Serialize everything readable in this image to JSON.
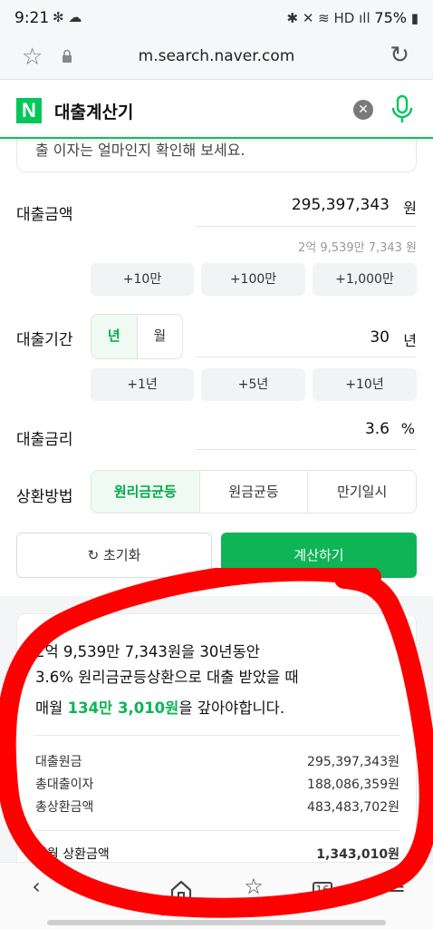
{
  "status_bar": {
    "time": "9:21",
    "left_icons": "✻ ☁",
    "right_icons": "✱ ✕ ≋ HD ıll",
    "battery": "75%"
  },
  "address_bar": {
    "url": "m.search.naver.com"
  },
  "search": {
    "logo": "N",
    "query": "대출계산기"
  },
  "intro": {
    "text": "출 이자는 얼마인지 확인해 보세요."
  },
  "loan_amount": {
    "label": "대출금액",
    "value": "295,397,343",
    "unit": "원",
    "hint": "2억 9,539만 7,343 원",
    "chips": [
      "+10만",
      "+100만",
      "+1,000만"
    ]
  },
  "loan_period": {
    "label": "대출기간",
    "toggle": [
      "년",
      "월"
    ],
    "value": "30",
    "unit": "년",
    "chips": [
      "+1년",
      "+5년",
      "+10년"
    ]
  },
  "loan_rate": {
    "label": "대출금리",
    "value": "3.6",
    "unit": "%"
  },
  "repayment": {
    "label": "상환방법",
    "options": [
      "원리금균등",
      "원금균등",
      "만기일시"
    ]
  },
  "actions": {
    "reset": "초기화",
    "calculate": "계산하기"
  },
  "result": {
    "line1": "2억 9,539만 7,343원을 30년동안",
    "line2": "3.6% 원리금균등상환으로 대출 받았을 때",
    "monthly_prefix": "매월 ",
    "monthly_amount": "134만 3,010원",
    "monthly_suffix": "을 갚아야합니다.",
    "rows": [
      {
        "label": "대출원금",
        "value": "295,397,343원"
      },
      {
        "label": "총대출이자",
        "value": "188,086,359원"
      },
      {
        "label": "총상환금액",
        "value": "483,483,702원"
      }
    ],
    "monthly_label": "매월 상환금액",
    "monthly_value": "1,343,010원"
  },
  "bottom_nav": {
    "tabs_count": "16"
  },
  "colors": {
    "accent": "#03c75a",
    "annotation": "#ff0000"
  }
}
